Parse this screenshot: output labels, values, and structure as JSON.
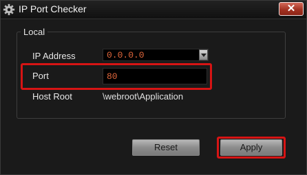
{
  "window": {
    "title": "IP Port Checker",
    "close_label": "✕"
  },
  "local_group": {
    "legend": "Local",
    "ip_address_label": "IP Address",
    "ip_address_value": "0.0.0.0",
    "port_label": "Port",
    "port_value": "80",
    "host_root_label": "Host Root",
    "host_root_value": "\\webroot\\Application"
  },
  "buttons": {
    "reset_label": "Reset",
    "apply_label": "Apply"
  },
  "colors": {
    "highlight": "#d71414",
    "value_text": "#e0663b"
  }
}
